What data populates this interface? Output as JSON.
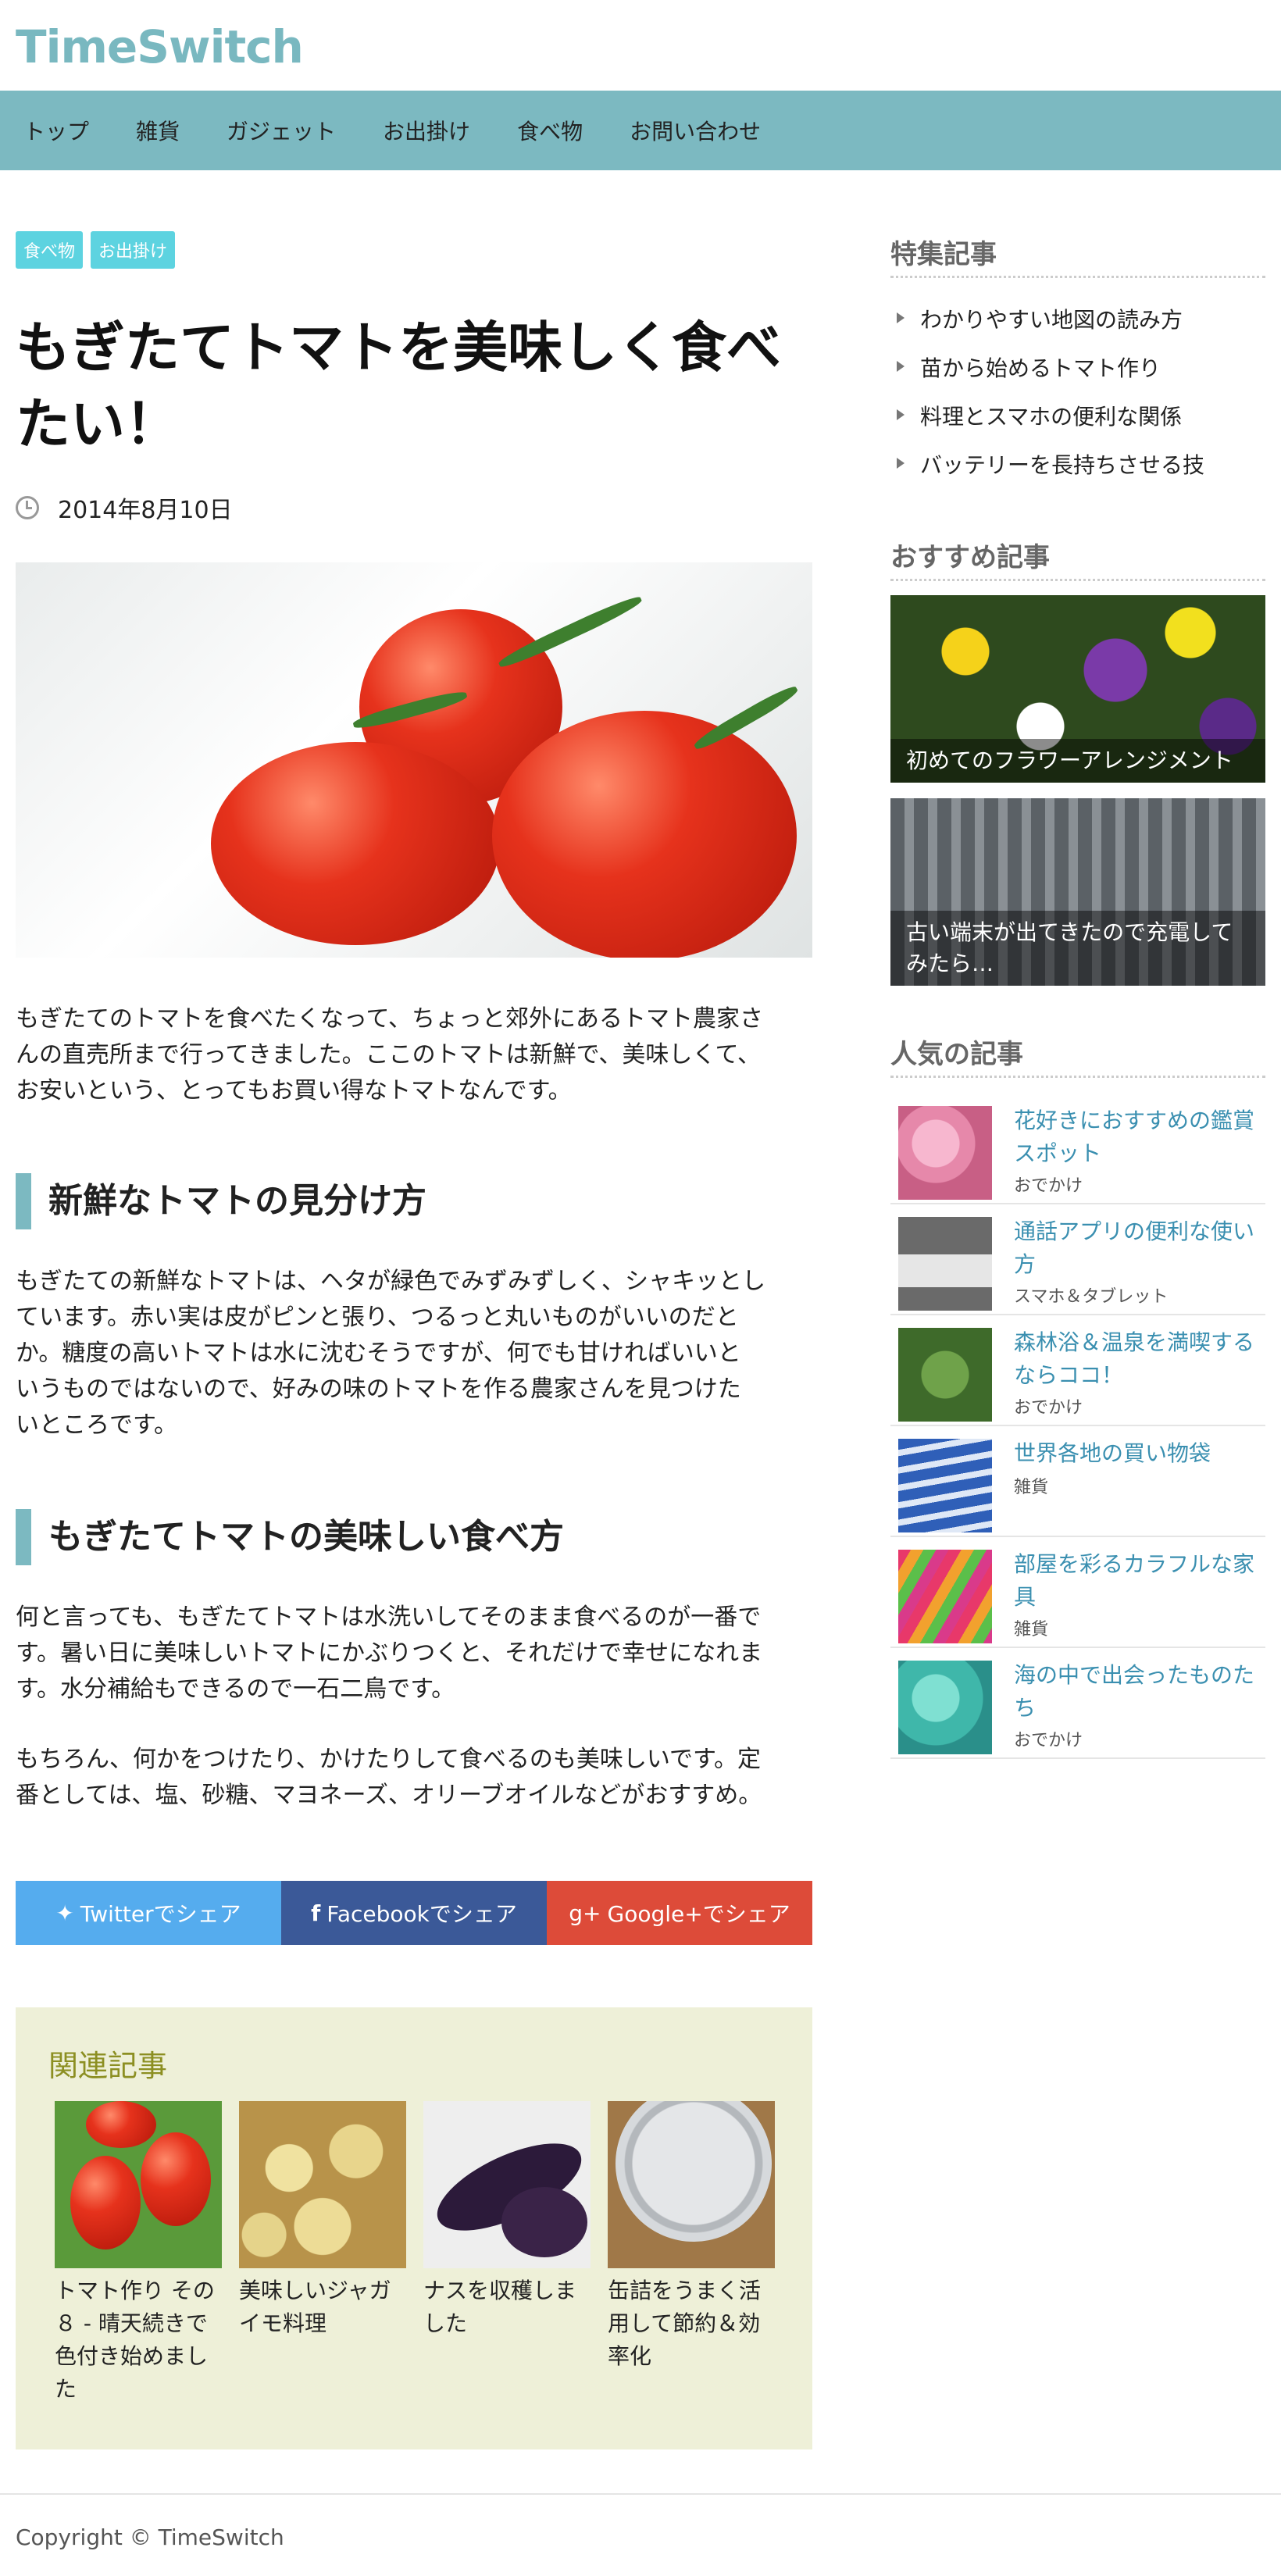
{
  "site": {
    "logo": "TimeSwitch"
  },
  "nav": [
    "トップ",
    "雑貨",
    "ガジェット",
    "お出掛け",
    "食べ物",
    "お問い合わせ"
  ],
  "article": {
    "tags": [
      "食べ物",
      "お出掛け"
    ],
    "title_line1": "もぎたてトマトを美味しく食べ",
    "title_line2": "たい！",
    "date": "2014年8月10日",
    "intro": [
      "もぎたてのトマトを食べたくなって、ちょっと郊外にあるトマト農家さ",
      "んの直売所まで行ってきました。ここのトマトは新鮮で、美味しくて、",
      "お安いという、とってもお買い得なトマトなんです。"
    ],
    "h2_1": "新鮮なトマトの見分け方",
    "p1": [
      "もぎたての新鮮なトマトは、ヘタが緑色でみずみずしく、シャキッとし",
      "ています。赤い実は皮がピンと張り、つるっと丸いものがいいのだと",
      "か。糖度の高いトマトは水に沈むそうですが、何でも甘ければいいと",
      "いうものではないので、好みの味のトマトを作る農家さんを見つけた",
      "いところです。"
    ],
    "h2_2": "もぎたてトマトの美味しい食べ方",
    "p2": [
      "何と言っても、もぎたてトマトは水洗いしてそのまま食べるのが一番で",
      "す。暑い日に美味しいトマトにかぶりつくと、それだけで幸せになれま",
      "す。水分補給もできるので一石二鳥です。"
    ],
    "p3": [
      "もちろん、何かをつけたり、かけたりして食べるのも美味しいです。定",
      "番としては、塩、砂糖、マヨネーズ、オリーブオイルなどがおすすめ。"
    ]
  },
  "share": {
    "twitter": "Twitterでシェア",
    "facebook": "Facebookでシェア",
    "google": "Google+でシェア",
    "colors": {
      "twitter": "#55acee",
      "facebook": "#3b5998",
      "google": "#dd4b39"
    }
  },
  "related": {
    "heading": "関連記事",
    "items": [
      {
        "lines": [
          "トマト作り その",
          "８ - 晴天続きで",
          "色付き始めまし",
          "た"
        ]
      },
      {
        "lines": [
          "美味しいジャガ",
          "イモ料理"
        ]
      },
      {
        "lines": [
          "ナスを収穫しま",
          "した"
        ]
      },
      {
        "lines": [
          "缶詰をうまく活",
          "用して節約＆効",
          "率化"
        ]
      }
    ]
  },
  "sidebar": {
    "featured_heading": "特集記事",
    "featured": [
      "わかりやすい地図の読み方",
      "苗から始めるトマト作り",
      "料理とスマホの便利な関係",
      "バッテリーを長持ちさせる技"
    ],
    "recommended_heading": "おすすめ記事",
    "recommended": [
      {
        "caption_lines": [
          "初めてのフラワーアレンジメント"
        ]
      },
      {
        "caption_lines": [
          "古い端末が出てきたので充電して",
          "みたら…"
        ]
      }
    ],
    "popular_heading": "人気の記事",
    "popular": [
      {
        "title_lines": [
          "花好きにおすすめの鑑賞",
          "スポット"
        ],
        "category": "おでかけ"
      },
      {
        "title_lines": [
          "通話アプリの便利な使い",
          "方"
        ],
        "category": "スマホ＆タブレット"
      },
      {
        "title_lines": [
          "森林浴＆温泉を満喫する",
          "ならココ！"
        ],
        "category": "おでかけ"
      },
      {
        "title_lines": [
          "世界各地の買い物袋"
        ],
        "category": "雑貨"
      },
      {
        "title_lines": [
          "部屋を彩るカラフルな家",
          "具"
        ],
        "category": "雑貨"
      },
      {
        "title_lines": [
          "海の中で出会ったものた",
          "ち"
        ],
        "category": "おでかけ"
      }
    ]
  },
  "footer": {
    "copyright": "Copyright © TimeSwitch"
  }
}
